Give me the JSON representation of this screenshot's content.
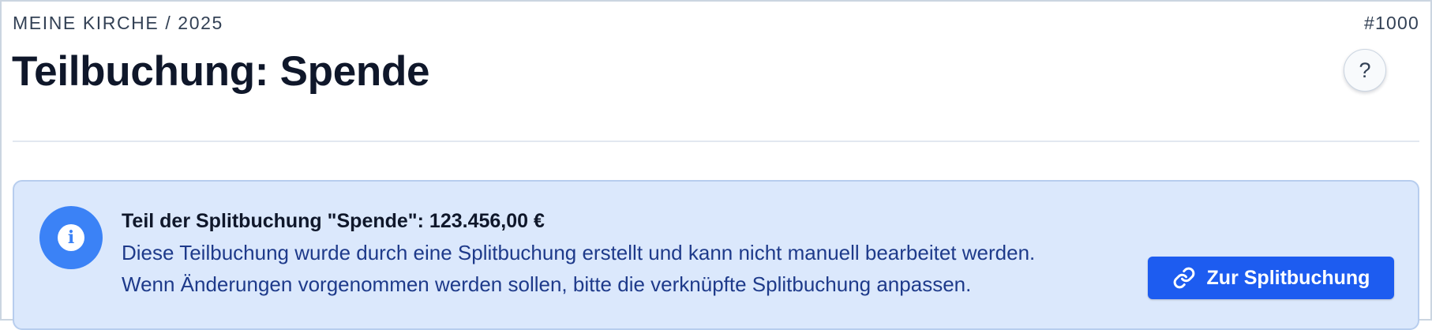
{
  "header": {
    "breadcrumb": "MEINE KIRCHE / 2025",
    "record_id": "#1000",
    "title": "Teilbuchung: Spende",
    "help_label": "?"
  },
  "notice": {
    "icon": "info-icon",
    "title": "Teil der Splitbuchung \"Spende\": 123.456,00 €",
    "line1": "Diese Teilbuchung wurde durch eine Splitbuchung erstellt und kann nicht manuell bearbeitet werden.",
    "line2": "Wenn Änderungen vorgenommen werden sollen, bitte die verknüpfte Splitbuchung anpassen.",
    "button_icon": "link-icon",
    "button_label": "Zur Splitbuchung"
  },
  "colors": {
    "notice_background": "#dbe8fc",
    "info_accent": "#3b82f6",
    "button_primary": "#1d5cf0"
  }
}
